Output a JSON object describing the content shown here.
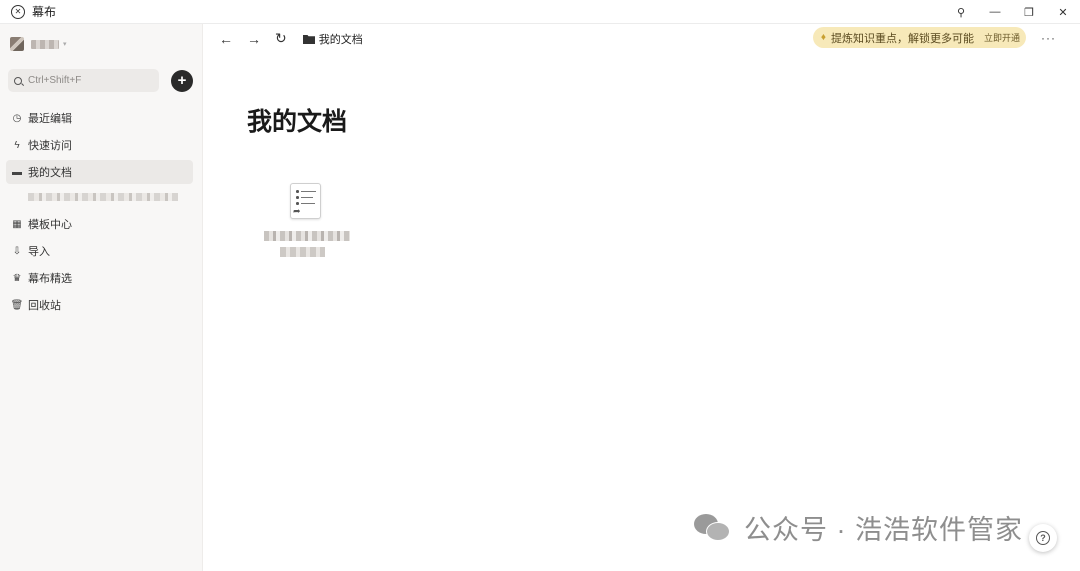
{
  "window": {
    "title": "幕布",
    "logo_glyph": "✕",
    "controls": {
      "pin": "⚲",
      "minimize": "—",
      "restore": "❐",
      "close": "✕"
    }
  },
  "sidebar": {
    "search_placeholder": "Ctrl+Shift+F",
    "add_symbol": "+",
    "items": [
      {
        "label": "最近编辑",
        "icon": "clock-icon",
        "glyph": "◷"
      },
      {
        "label": "快速访问",
        "icon": "lightning-icon",
        "glyph": "ϟ"
      },
      {
        "label": "我的文档",
        "icon": "folder-icon",
        "glyph": "▬",
        "active": true
      },
      {
        "label": "模板中心",
        "icon": "template-icon",
        "glyph": "▦"
      },
      {
        "label": "导入",
        "icon": "import-icon",
        "glyph": "⇩"
      },
      {
        "label": "幕布精选",
        "icon": "crown-icon",
        "glyph": "♛"
      },
      {
        "label": "回收站",
        "icon": "trash-icon",
        "glyph": "🗑"
      }
    ]
  },
  "toolbar": {
    "back": "←",
    "forward": "→",
    "refresh": "↻",
    "breadcrumb": "我的文档",
    "upgrade_text": "提炼知识重点，解锁更多可能",
    "upgrade_cta": "立即开通",
    "upgrade_icon": "♦",
    "more": "···"
  },
  "main": {
    "title": "我的文档"
  },
  "watermark": {
    "text": "公众号 · 浩浩软件管家"
  },
  "help": {
    "symbol": "?"
  },
  "colors": {
    "sidebar_bg": "#f8f7f6",
    "upgrade_bg": "#f7e9b9",
    "accent_dark": "#2a2a2a"
  }
}
